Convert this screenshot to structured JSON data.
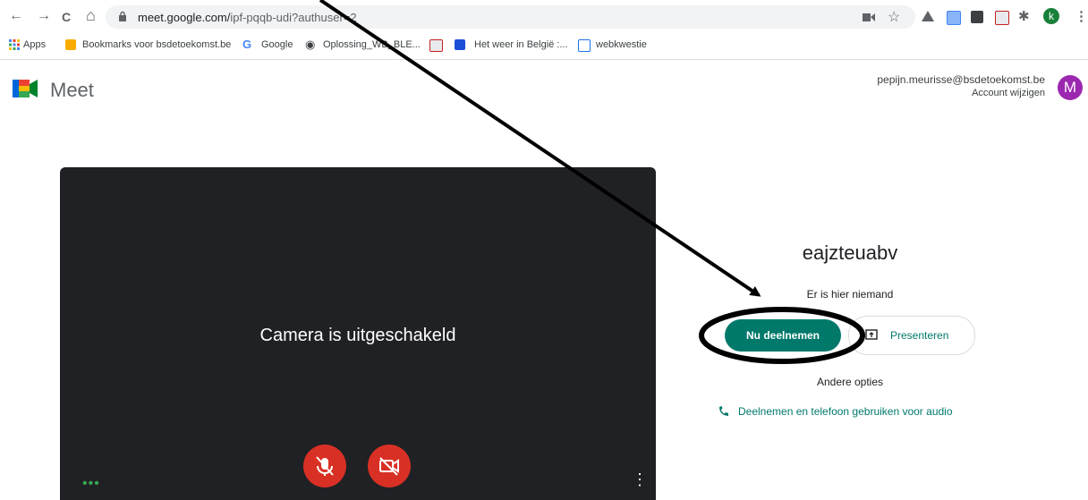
{
  "browser": {
    "url_main": "meet.google.com/",
    "url_rest": "ipf-pqqb-udi?authuser=2",
    "nav": [
      "←",
      "→",
      "C",
      "⌂"
    ],
    "profile_initial": "k"
  },
  "bookmarks": [
    {
      "label": "Apps",
      "icon": "apps-grid-icon"
    },
    {
      "label": "Bookmarks voor bsdetoekomst.be",
      "icon": "folder-icon"
    },
    {
      "label": "Google",
      "icon": "google-icon"
    },
    {
      "label": "Oplossing_WB_BLE...",
      "icon": "globe-icon"
    },
    {
      "label": "",
      "icon": "pdf-icon"
    },
    {
      "label": "Het weer in België :...",
      "icon": "weather-icon"
    },
    {
      "label": "webkwestie",
      "icon": "page-icon"
    }
  ],
  "meet": {
    "app_name": "Meet",
    "account_email": "pepijn.meurisse@bsdetoekomst.be",
    "account_switch": "Account wijzigen",
    "avatar_initial": "M"
  },
  "video": {
    "camera_off_text": "Camera is uitgeschakeld",
    "more_dots": "•••"
  },
  "panel": {
    "room_name": "eajzteuabv",
    "status": "Er is hier niemand",
    "join_label": "Nu deelnemen",
    "present_label": "Presenteren",
    "other_options": "Andere opties",
    "phone_audio": "Deelnemen en telefoon gebruiken voor audio"
  },
  "colors": {
    "accent": "#00796b",
    "mic_camera_off": "#d93025",
    "video_bg": "#202124",
    "avatar": "#9c27b0"
  }
}
